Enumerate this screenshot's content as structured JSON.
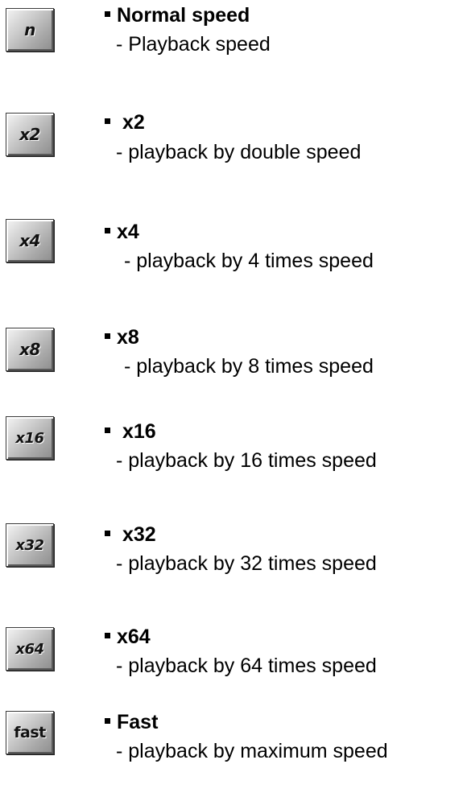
{
  "items": [
    {
      "icon_label": "n",
      "title": "Normal speed",
      "description": "- Playback speed"
    },
    {
      "icon_label": "x2",
      "title": "x2",
      "description": "- playback by double speed"
    },
    {
      "icon_label": "x4",
      "title": "x4",
      "description": "- playback by 4 times speed"
    },
    {
      "icon_label": "x8",
      "title": "x8",
      "description": "- playback by 8 times speed"
    },
    {
      "icon_label": "x16",
      "title": "x16",
      "description": "- playback by 16 times speed"
    },
    {
      "icon_label": "x32",
      "title": "x32",
      "description": "- playback by 32 times speed"
    },
    {
      "icon_label": "x64",
      "title": "x64",
      "description": "- playback by 64 times speed"
    },
    {
      "icon_label": "fast",
      "title": "Fast",
      "description": "- playback by maximum speed"
    }
  ]
}
